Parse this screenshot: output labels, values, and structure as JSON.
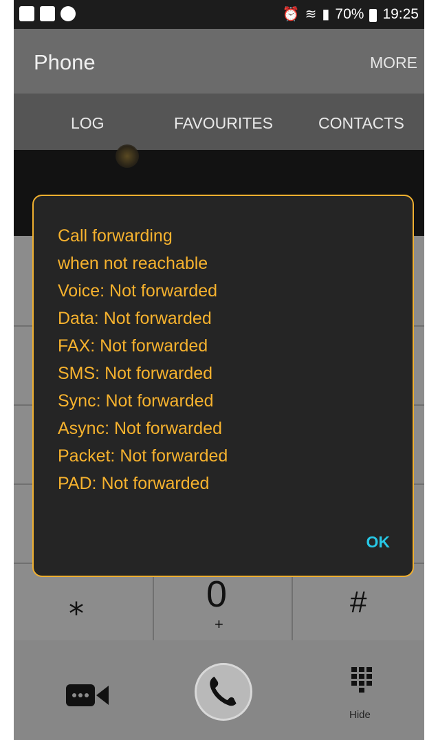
{
  "statusbar": {
    "left_icons": [
      "gallery-icon",
      "photo-sync-icon",
      "messenger-icon"
    ],
    "right_icons": [
      "alarm-icon",
      "wifi-icon",
      "signal-icon",
      "battery-icon"
    ],
    "battery_percent": "70%",
    "time": "19:25"
  },
  "appbar": {
    "title": "Phone",
    "more_label": "MORE"
  },
  "tabs": [
    {
      "label": "LOG"
    },
    {
      "label": "FAVOURITES"
    },
    {
      "label": "CONTACTS"
    }
  ],
  "keypad": {
    "visible_keys": [
      {
        "key": "star",
        "symbol": "⁎"
      },
      {
        "key": "zero",
        "symbol": "0",
        "sub": "+"
      },
      {
        "key": "hash",
        "symbol": "#"
      }
    ]
  },
  "bottom_bar": {
    "video_call_icon": "video-call-icon",
    "call_icon": "phone-icon",
    "dialpad_icon": "dialpad-icon",
    "hide_label": "Hide"
  },
  "dialog": {
    "lines": [
      "Call forwarding",
      "when not reachable",
      "Voice: Not forwarded",
      "Data: Not forwarded",
      "FAX: Not forwarded",
      "SMS: Not forwarded",
      "Sync: Not forwarded",
      "Async: Not forwarded",
      "Packet: Not forwarded",
      "PAD: Not forwarded"
    ],
    "ok_label": "OK"
  },
  "colors": {
    "dialog_text": "#f6b22e",
    "dialog_border": "#f0b030",
    "ok_text": "#27c8e6"
  }
}
